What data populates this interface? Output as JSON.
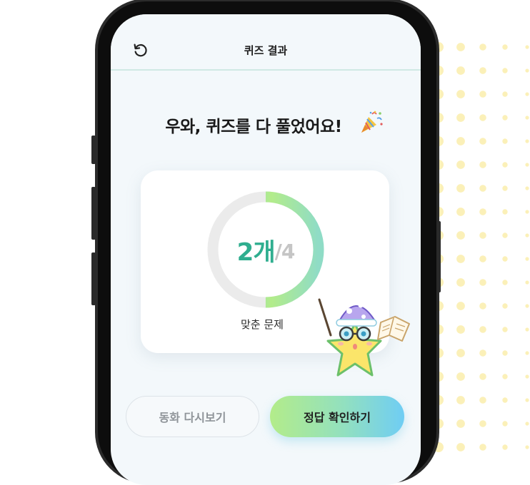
{
  "header": {
    "title": "퀴즈 결과",
    "back_icon": "refresh-icon"
  },
  "main": {
    "headline": "우와, 퀴즈를 다 풀었어요!",
    "headline_icon": "party-popper-icon",
    "result": {
      "correct": 2,
      "total": 4,
      "correct_label": "2개",
      "total_label": "/4",
      "caption": "맞춘 문제"
    },
    "actions": {
      "replay_label": "동화 다시보기",
      "answers_label": "정답 확인하기"
    },
    "mascot_icon": "star-mascot-icon"
  },
  "colors": {
    "accent_green": "#2fae8f",
    "ring_start": "#6fcdf4",
    "ring_end": "#b3ec8a",
    "ring_track": "#ebebeb",
    "dots": "#fbf0b8"
  }
}
